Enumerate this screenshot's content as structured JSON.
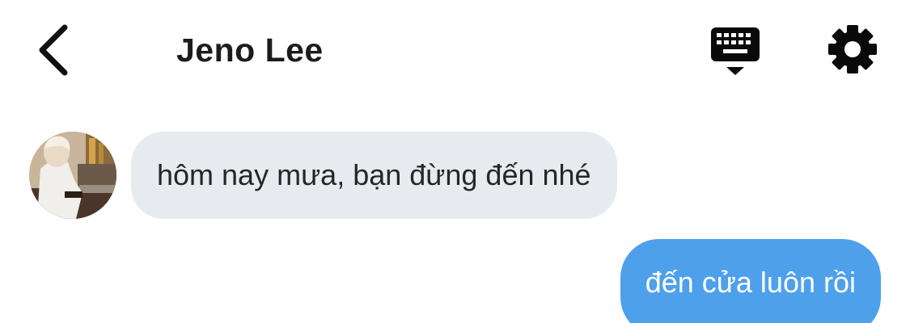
{
  "header": {
    "back_icon": "chevron-left-icon",
    "title": "Jeno Lee",
    "keyboard_icon": "keyboard-hide-icon",
    "settings_icon": "gear-icon"
  },
  "colors": {
    "incoming_bubble": "#e7ebef",
    "outgoing_bubble": "#4ea0eb",
    "text_dark": "#1c1c1e"
  },
  "messages": [
    {
      "direction": "incoming",
      "text": "hôm nay mưa, bạn đừng đến nhé"
    },
    {
      "direction": "outgoing",
      "text": "đến cửa luôn rồi"
    }
  ]
}
